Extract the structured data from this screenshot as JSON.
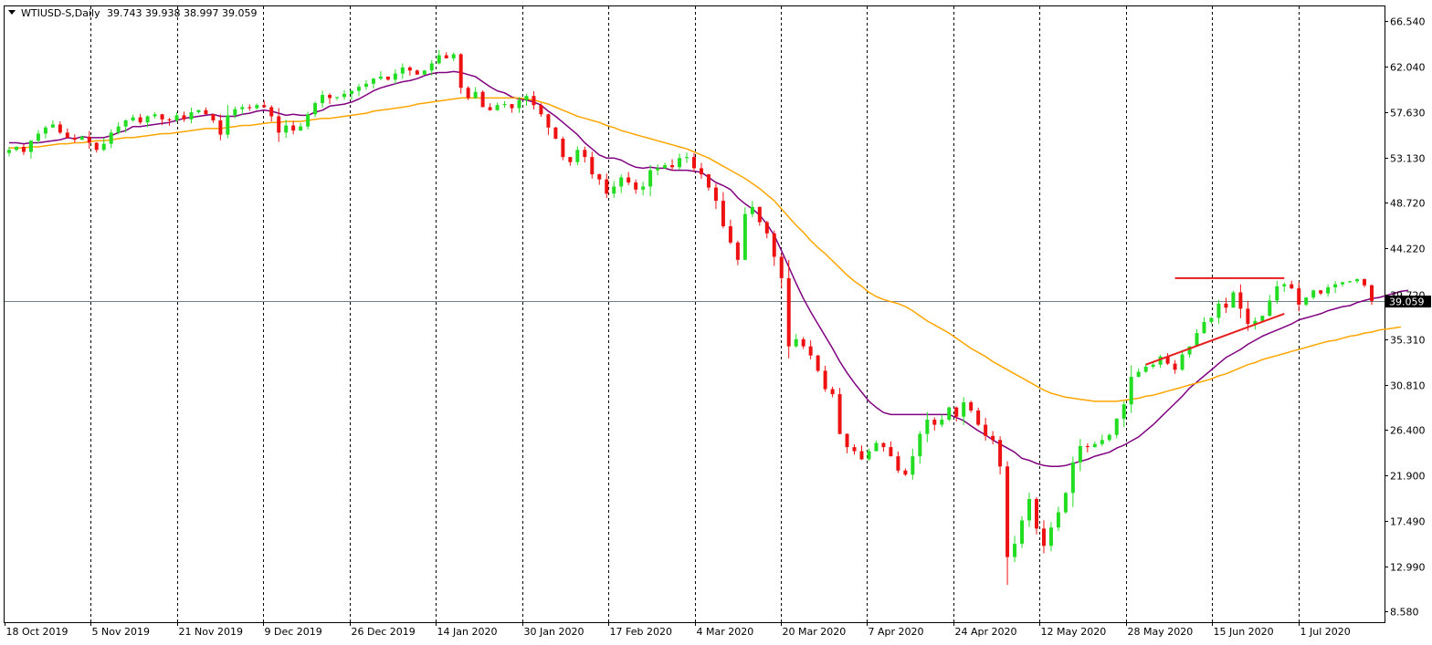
{
  "header": {
    "symbol": "WTIUSD-S,Daily",
    "ohlc": "39.743 39.938 38.997 39.059"
  },
  "current_price_label": "39.059",
  "colors": {
    "background": "#ffffff",
    "frame": "#000000",
    "bull_candle": "#22dd22",
    "bear_candle": "#ee1111",
    "ma_fast": "#800080",
    "ma_slow": "#ffa500",
    "price_line": "#708090",
    "price_tag_bg": "#000000",
    "trendline": "#e81c1c",
    "grid": "#000000"
  },
  "chart_data": {
    "type": "candlestick",
    "title": "",
    "grid": "vertical dashed separators",
    "y_axis_side": "right",
    "ylim": [
      7.5,
      68.0
    ],
    "y_ticks": [
      "66.540",
      "62.040",
      "57.630",
      "53.130",
      "48.720",
      "44.220",
      "39.720",
      "35.310",
      "30.810",
      "26.400",
      "21.900",
      "17.490",
      "12.990",
      "8.580"
    ],
    "x_tick_labels": [
      "18 Oct 2019",
      "5 Nov 2019",
      "21 Nov 2019",
      "9 Dec 2019",
      "26 Dec 2019",
      "14 Jan 2020",
      "30 Jan 2020",
      "17 Feb 2020",
      "4 Mar 2020",
      "20 Mar 2020",
      "7 Apr 2020",
      "24 Apr 2020",
      "12 May 2020",
      "28 May 2020",
      "15 Jun 2020",
      "1 Jul 2020"
    ],
    "close_prices": [
      53.9,
      54.2,
      53.7,
      54.8,
      55.5,
      56.1,
      56.4,
      55.6,
      55.1,
      54.9,
      55.2,
      54.6,
      53.9,
      54.5,
      55.6,
      56.2,
      56.8,
      57.1,
      56.6,
      57.2,
      57.4,
      56.9,
      56.8,
      57.3,
      56.9,
      57.6,
      57.8,
      57.4,
      56.8,
      55.4,
      57.3,
      57.9,
      58.1,
      58.0,
      58.3,
      58.1,
      57.2,
      55.6,
      56.3,
      55.8,
      56.2,
      57.4,
      58.5,
      59.3,
      59.0,
      59.1,
      59.4,
      59.7,
      60.1,
      60.4,
      60.9,
      61.1,
      60.8,
      61.4,
      62.0,
      61.7,
      61.3,
      61.7,
      62.4,
      63.2,
      62.9,
      63.3,
      60.0,
      59.0,
      59.6,
      58.1,
      57.8,
      58.3,
      58.4,
      58.0,
      58.8,
      59.2,
      58.3,
      57.4,
      56.1,
      55.0,
      53.2,
      52.7,
      53.9,
      53.2,
      51.5,
      51.0,
      49.6,
      50.3,
      51.2,
      50.7,
      50.0,
      50.3,
      51.9,
      52.1,
      52.4,
      52.2,
      53.1,
      53.2,
      52.1,
      51.5,
      50.2,
      48.9,
      46.4,
      44.8,
      43.1,
      47.6,
      48.3,
      46.8,
      45.7,
      43.4,
      41.3,
      34.6,
      35.3,
      34.6,
      33.7,
      32.2,
      30.4,
      29.9,
      26.0,
      24.7,
      24.3,
      23.5,
      24.3,
      25.1,
      24.7,
      23.8,
      22.4,
      22.0,
      23.8,
      26.0,
      27.4,
      26.9,
      27.4,
      28.6,
      27.7,
      29.1,
      28.3,
      26.9,
      25.8,
      25.4,
      22.8,
      13.9,
      15.2,
      17.5,
      19.6,
      16.7,
      15.0,
      16.8,
      18.3,
      20.2,
      23.2,
      24.8,
      24.7,
      25.0,
      25.4,
      25.9,
      27.5,
      28.9,
      31.6,
      32.1,
      32.6,
      32.8,
      33.6,
      32.9,
      32.3,
      33.8,
      34.6,
      35.9,
      37.0,
      37.4,
      38.8,
      38.4,
      39.9,
      38.3,
      36.8,
      37.1,
      37.6,
      39.1,
      40.5,
      40.7,
      40.3,
      38.7,
      39.4,
      40.1,
      39.8,
      40.4,
      40.7,
      40.9,
      41.0,
      41.2,
      40.6,
      39.06
    ],
    "series": [
      {
        "name": "",
        "type": "ma",
        "values": [
          54.6,
          54.6,
          54.5,
          54.6,
          54.6,
          54.7,
          54.8,
          54.9,
          55.1,
          55.0,
          55.2,
          55.1,
          55.1,
          55.1,
          55.3,
          55.6,
          55.8,
          56.2,
          56.2,
          56.3,
          56.4,
          56.5,
          56.6,
          56.8,
          57.0,
          57.1,
          57.2,
          57.3,
          57.4,
          57.2,
          57.2,
          57.2,
          57.4,
          57.5,
          57.7,
          57.8,
          57.7,
          57.5,
          57.3,
          57.4,
          57.3,
          57.3,
          57.6,
          57.8,
          58.2,
          58.3,
          58.4,
          58.6,
          58.9,
          59.3,
          59.7,
          60.0,
          60.2,
          60.4,
          60.6,
          60.7,
          60.9,
          61.2,
          61.4,
          61.5,
          61.5,
          61.6,
          61.5,
          61.3,
          61.1,
          60.6,
          60.1,
          59.7,
          59.5,
          59.1,
          58.9,
          58.8,
          58.6,
          58.3,
          57.7,
          57.2,
          56.6,
          56.0,
          55.4,
          54.6,
          54.0,
          53.4,
          53.1,
          53.1,
          52.9,
          52.5,
          52.2,
          52.1,
          52.2,
          52.1,
          52.1,
          51.9,
          51.9,
          51.9,
          51.8,
          51.7,
          51.2,
          50.7,
          50.4,
          50.0,
          49.2,
          48.6,
          48.1,
          47.5,
          46.6,
          45.5,
          44.0,
          42.4,
          40.8,
          39.3,
          38.0,
          36.8,
          35.6,
          34.4,
          33.1,
          32.0,
          31.0,
          30.1,
          29.2,
          28.6,
          28.1,
          27.9,
          27.9,
          27.9,
          27.9,
          27.9,
          27.9,
          27.9,
          27.9,
          27.9,
          27.6,
          27.3,
          26.8,
          26.3,
          25.9,
          25.4,
          25.0,
          24.6,
          24.2,
          23.6,
          23.4,
          23.1,
          22.9,
          22.8,
          22.8,
          22.9,
          23.1,
          23.3,
          23.5,
          23.8,
          24.0,
          24.2,
          24.6,
          24.9,
          25.3,
          25.7,
          26.3,
          26.9,
          27.6,
          28.3,
          29.0,
          29.7,
          30.5,
          31.1,
          31.7,
          32.3,
          32.9,
          33.5,
          33.9,
          34.3,
          34.8,
          35.2,
          35.6,
          35.9,
          36.2,
          36.5,
          36.8,
          37.2,
          37.4,
          37.6,
          37.8,
          38.1,
          38.3,
          38.5,
          38.6,
          38.9,
          39.1,
          39.3,
          39.4,
          39.6,
          39.8,
          40.0,
          40.1
        ]
      },
      {
        "name": "",
        "type": "ma",
        "values": [
          54.1,
          54.1,
          54.1,
          54.2,
          54.2,
          54.3,
          54.4,
          54.5,
          54.5,
          54.6,
          54.6,
          54.7,
          54.8,
          54.8,
          54.9,
          55.0,
          55.1,
          55.1,
          55.2,
          55.3,
          55.4,
          55.5,
          55.5,
          55.6,
          55.7,
          55.8,
          55.9,
          56.0,
          56.0,
          56.0,
          56.1,
          56.2,
          56.3,
          56.3,
          56.4,
          56.5,
          56.6,
          56.6,
          56.7,
          56.7,
          56.7,
          56.8,
          56.9,
          57.0,
          57.0,
          57.1,
          57.2,
          57.3,
          57.4,
          57.5,
          57.7,
          57.8,
          57.9,
          58.0,
          58.1,
          58.2,
          58.4,
          58.5,
          58.6,
          58.7,
          58.8,
          58.9,
          59.0,
          59.0,
          59.0,
          59.0,
          59.0,
          59.0,
          59.0,
          59.0,
          59.0,
          58.9,
          58.8,
          58.6,
          58.4,
          58.1,
          57.8,
          57.5,
          57.2,
          57.0,
          56.8,
          56.6,
          56.3,
          56.1,
          55.8,
          55.6,
          55.4,
          55.2,
          55.0,
          54.8,
          54.6,
          54.4,
          54.2,
          54.0,
          53.7,
          53.4,
          53.1,
          52.7,
          52.3,
          51.9,
          51.5,
          51.1,
          50.6,
          50.1,
          49.5,
          48.9,
          48.1,
          47.3,
          46.5,
          45.8,
          45.0,
          44.3,
          43.7,
          43.0,
          42.3,
          41.6,
          41.0,
          40.5,
          39.9,
          39.5,
          39.2,
          39.0,
          38.8,
          38.5,
          38.1,
          37.6,
          37.1,
          36.7,
          36.3,
          35.9,
          35.4,
          34.9,
          34.4,
          34.0,
          33.6,
          33.1,
          32.7,
          32.3,
          31.9,
          31.5,
          31.1,
          30.7,
          30.3,
          30.0,
          29.8,
          29.6,
          29.5,
          29.4,
          29.3,
          29.2,
          29.2,
          29.2,
          29.2,
          29.3,
          29.4,
          29.5,
          29.7,
          29.8,
          30.0,
          30.2,
          30.4,
          30.6,
          30.8,
          31.0,
          31.2,
          31.4,
          31.7,
          31.9,
          32.2,
          32.5,
          32.8,
          33.0,
          33.3,
          33.5,
          33.7,
          33.9,
          34.1,
          34.3,
          34.5,
          34.7,
          34.9,
          35.1,
          35.2,
          35.4,
          35.6,
          35.7,
          35.9,
          36.0,
          36.2,
          36.3,
          36.4,
          36.5
        ]
      }
    ],
    "annotations": [
      {
        "type": "horizontal_segment",
        "price": 41.3,
        "from_index": 160,
        "to_index": 175
      },
      {
        "type": "trendline",
        "from_index": 156,
        "from_price": 32.8,
        "to_index": 175,
        "to_price": 37.8
      }
    ],
    "current_price": 39.059
  }
}
